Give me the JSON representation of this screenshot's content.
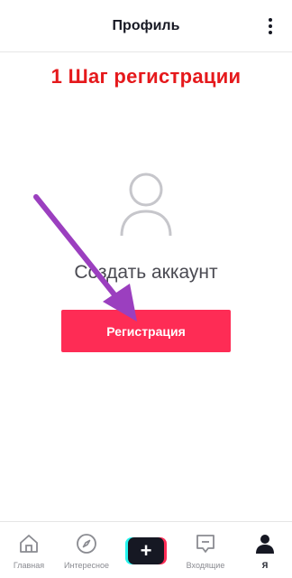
{
  "header": {
    "title": "Профиль",
    "more_icon": "more-vertical-icon"
  },
  "annotation": {
    "text": "1 Шаг регистрации",
    "color": "#e5191c"
  },
  "profile": {
    "avatar_icon": "user-avatar-icon",
    "create_account_label": "Создать аккаунт"
  },
  "register_button": {
    "label": "Регистрация",
    "color": "#fe2c55"
  },
  "overlay": {
    "arrow_icon": "pointer-arrow-icon",
    "arrow_color": "#9b3fbf"
  },
  "tabbar": {
    "items": [
      {
        "label": "Главная",
        "icon": "home-icon",
        "active": false
      },
      {
        "label": "Интересное",
        "icon": "compass-icon",
        "active": false
      },
      {
        "label": "",
        "icon": "plus-icon",
        "active": false
      },
      {
        "label": "Входящие",
        "icon": "inbox-icon",
        "active": false
      },
      {
        "label": "Я",
        "icon": "profile-icon",
        "active": true
      }
    ]
  }
}
